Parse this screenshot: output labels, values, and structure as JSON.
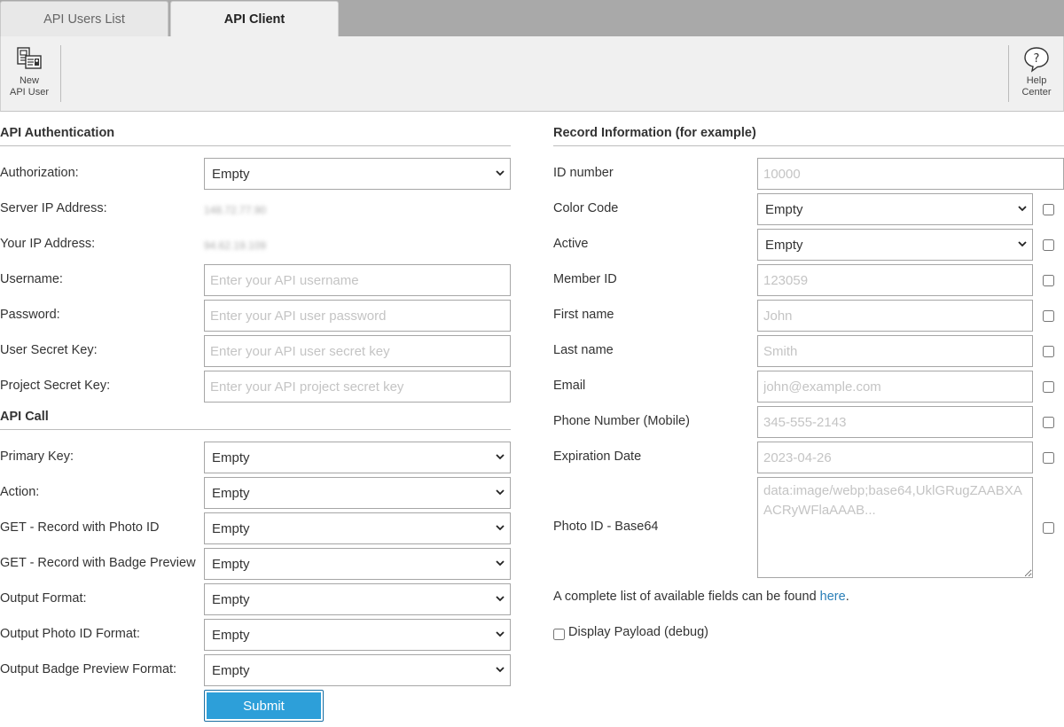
{
  "tabs": [
    {
      "label": "API Users List",
      "active": false
    },
    {
      "label": "API Client",
      "active": true
    }
  ],
  "toolbar": {
    "new_user_line1": "New",
    "new_user_line2": "API User",
    "help_line1": "Help",
    "help_line2": "Center"
  },
  "auth": {
    "title": "API Authentication",
    "authorization_label": "Authorization:",
    "authorization_value": "Empty",
    "server_ip_label": "Server IP Address:",
    "server_ip_value": "148.72.77.90",
    "your_ip_label": "Your IP Address:",
    "your_ip_value": "94.62.19.109",
    "username_label": "Username:",
    "username_placeholder": "Enter your API username",
    "password_label": "Password:",
    "password_placeholder": "Enter your API user password",
    "user_secret_label": "User Secret Key:",
    "user_secret_placeholder": "Enter your API user secret key",
    "project_secret_label": "Project Secret Key:",
    "project_secret_placeholder": "Enter your API project secret key"
  },
  "call": {
    "title": "API Call",
    "primary_key_label": "Primary Key:",
    "primary_key_value": "Empty",
    "action_label": "Action:",
    "action_value": "Empty",
    "get_photo_label": "GET - Record with Photo ID",
    "get_photo_value": "Empty",
    "get_badge_label": "GET - Record with Badge Preview",
    "get_badge_value": "Empty",
    "output_format_label": "Output Format:",
    "output_format_value": "Empty",
    "output_photo_label": "Output Photo ID Format:",
    "output_photo_value": "Empty",
    "output_badge_label": "Output Badge Preview Format:",
    "output_badge_value": "Empty",
    "submit_label": "Submit"
  },
  "record": {
    "title": "Record Information (for example)",
    "id_label": "ID number",
    "id_placeholder": "10000",
    "color_label": "Color Code",
    "color_value": "Empty",
    "active_label": "Active",
    "active_value": "Empty",
    "member_label": "Member ID",
    "member_placeholder": "123059",
    "first_label": "First name",
    "first_placeholder": "John",
    "last_label": "Last name",
    "last_placeholder": "Smith",
    "email_label": "Email",
    "email_placeholder": "john@example.com",
    "phone_label": "Phone Number (Mobile)",
    "phone_placeholder": "345-555-2143",
    "exp_label": "Expiration Date",
    "exp_placeholder": "2023-04-26",
    "photo_label": "Photo ID - Base64",
    "photo_placeholder": "data:image/webp;base64,UklGRugZAABXAACRyWFlaAAAB...",
    "fields_note_prefix": "A complete list of available fields can be found ",
    "fields_note_link": "here",
    "fields_note_suffix": ".",
    "display_payload_label": "Display Payload (debug)"
  },
  "colors": {
    "accent": "#2d9fd9",
    "link": "#2a7fb8",
    "tabbar": "#a9a9a9",
    "toolbar": "#f0f0f0"
  }
}
